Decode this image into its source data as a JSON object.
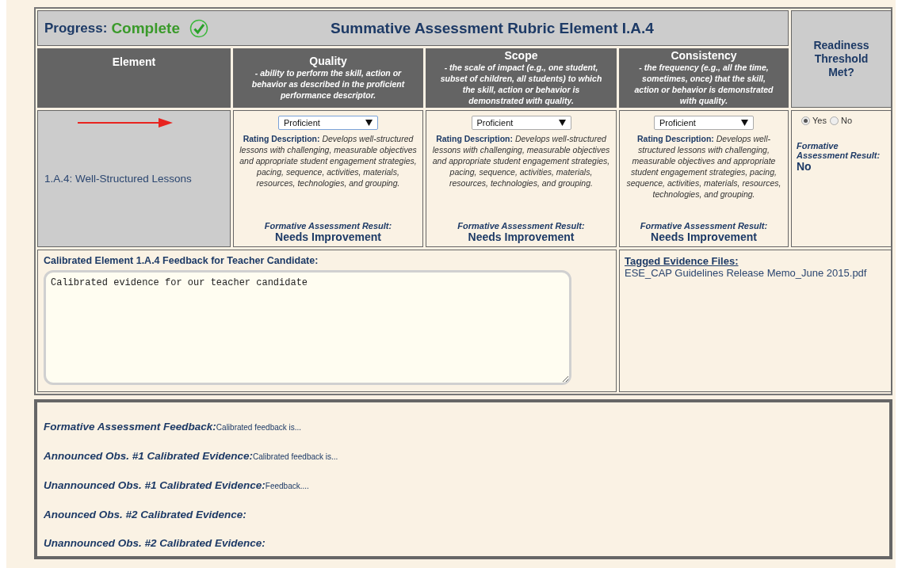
{
  "header": {
    "progress_label": "Progress:",
    "progress_value": "Complete",
    "progress_complete": true,
    "title": "Summative Assessment Rubric Element I.A.4",
    "readiness_heading": "Readiness Threshold Met?"
  },
  "columns": [
    {
      "name": "Element"
    },
    {
      "name": "Quality",
      "description": "- ability to perform the skill, action or behavior as described in the proficient performance descriptor."
    },
    {
      "name": "Scope",
      "description": "- the scale of impact (e.g., one student, subset of children, all students) to which the skill, action or behavior is demonstrated with quality."
    },
    {
      "name": "Consistency",
      "description": "- the frequency (e.g., all the time, sometimes, once) that the skill, action or behavior is demonstrated with quality."
    }
  ],
  "element": {
    "label": "1.A.4: Well-Structured Lessons"
  },
  "ratings": [
    {
      "selection": "Proficient",
      "description_label": "Rating Description:",
      "description": "Develops well-structured lessons with challenging, measurable objectives and appropriate student engagement strategies, pacing, sequence, activities, materials, resources, technologies, and grouping.",
      "result_label": "Formative Assessment Result:",
      "result": "Needs Improvement"
    },
    {
      "selection": "Proficient",
      "description_label": "Rating Description:",
      "description": "Develops well-structured lessons with challenging, measurable objectives and appropriate student engagement strategies, pacing, sequence, activities, materials, resources, technologies, and grouping.",
      "result_label": "Formative Assessment Result:",
      "result": "Needs Improvement"
    },
    {
      "selection": "Proficient",
      "description_label": "Rating Description:",
      "description": "Develops well-structured lessons with challenging, measurable objectives and appropriate student engagement strategies, pacing, sequence, activities, materials, resources, technologies, and grouping.",
      "result_label": "Formative Assessment Result:",
      "result": "Needs Improvement"
    }
  ],
  "readiness": {
    "options": [
      {
        "label": "Yes",
        "selected": true
      },
      {
        "label": "No",
        "selected": false
      }
    ],
    "result_label": "Formative Assessment Result:",
    "result": "No"
  },
  "feedback": {
    "label": "Calibrated Element 1.A.4 Feedback for Teacher Candidate:",
    "value": "Calibrated evidence for our teacher candidate"
  },
  "evidence": {
    "heading": "Tagged Evidence Files:",
    "files": [
      "ESE_CAP Guidelines Release Memo_June 2015.pdf"
    ]
  },
  "summary": [
    {
      "label": "Formative Assessment Feedback:",
      "value": "Calibrated feedback is..."
    },
    {
      "label": "Announced Obs. #1 Calibrated Evidence:",
      "value": "Calibrated feedback is..."
    },
    {
      "label": "Unannounced Obs. #1 Calibrated Evidence:",
      "value": "Feedback...."
    },
    {
      "label": "Anounced Obs. #2 Calibrated Evidence:"
    },
    {
      "label": "Unannounced Obs. #2 Calibrated Evidence:"
    }
  ]
}
